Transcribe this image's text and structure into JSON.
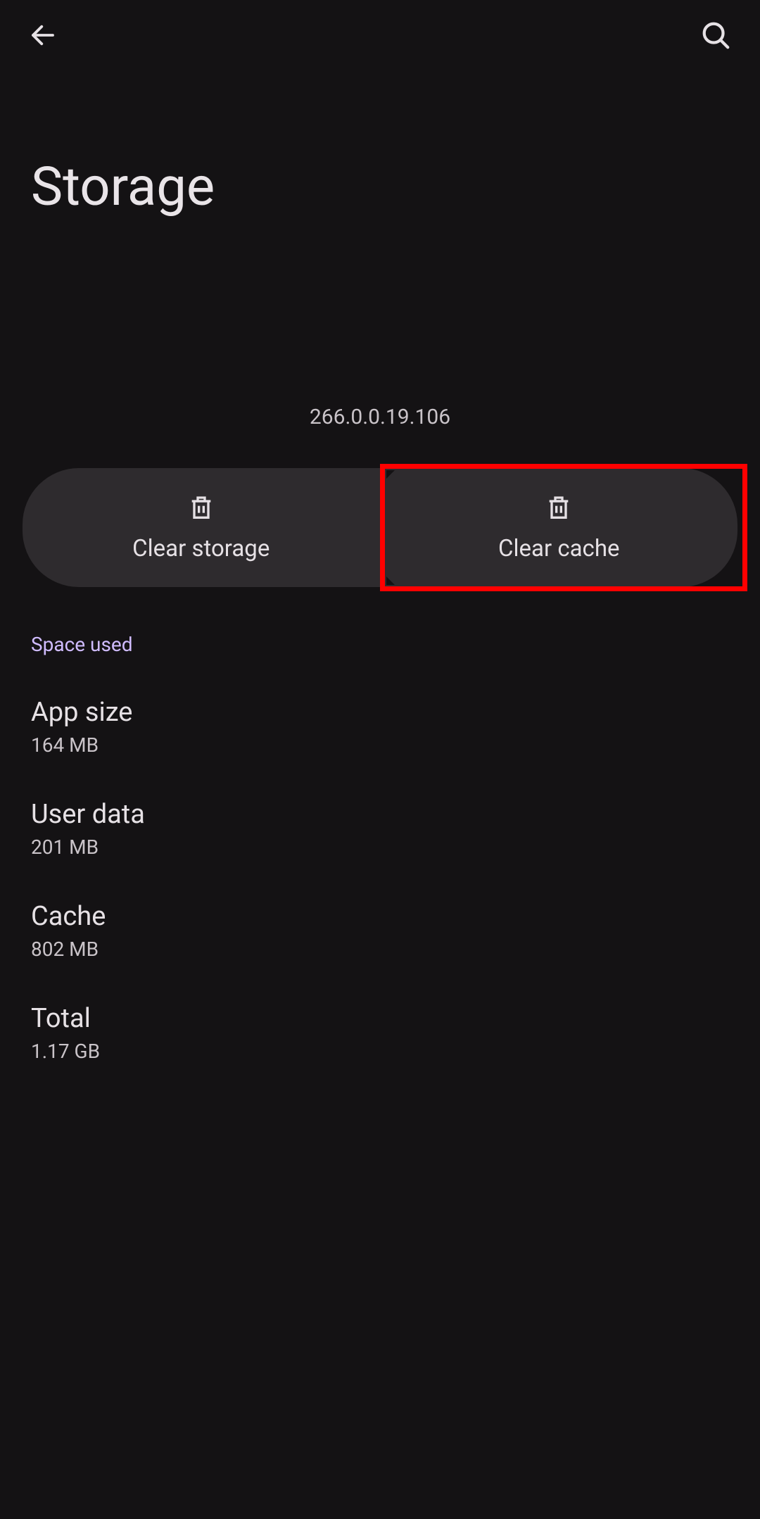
{
  "header": {
    "title": "Storage"
  },
  "app": {
    "version": "266.0.0.19.106"
  },
  "actions": {
    "clear_storage_label": "Clear storage",
    "clear_cache_label": "Clear cache"
  },
  "space_used": {
    "section_title": "Space used",
    "items": [
      {
        "label": "App size",
        "value": "164 MB"
      },
      {
        "label": "User data",
        "value": "201 MB"
      },
      {
        "label": "Cache",
        "value": "802 MB"
      },
      {
        "label": "Total",
        "value": "1.17 GB"
      }
    ]
  }
}
